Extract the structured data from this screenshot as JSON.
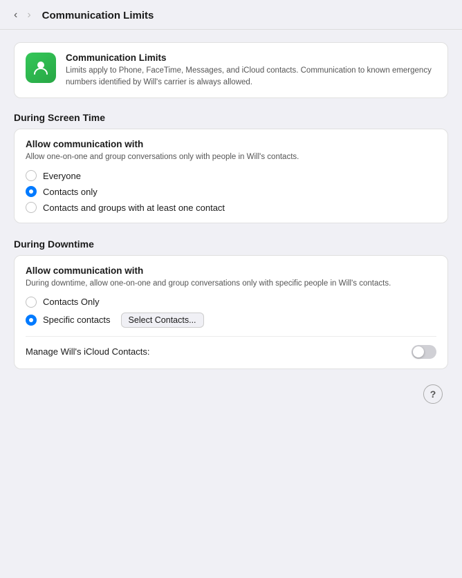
{
  "topBar": {
    "title": "Communication Limits",
    "backEnabled": true,
    "forwardEnabled": false
  },
  "infoCard": {
    "title": "Communication Limits",
    "description": "Limits apply to Phone, FaceTime, Messages, and iCloud contacts. Communication to known emergency numbers identified by Will's carrier is always allowed."
  },
  "screenTime": {
    "sectionHeading": "During Screen Time",
    "panelTitle": "Allow communication with",
    "panelDesc": "Allow one-on-one and group conversations only with people in Will's contacts.",
    "options": [
      {
        "id": "st-everyone",
        "label": "Everyone",
        "selected": false
      },
      {
        "id": "st-contacts-only",
        "label": "Contacts only",
        "selected": true
      },
      {
        "id": "st-contacts-groups",
        "label": "Contacts and groups with at least one contact",
        "selected": false
      }
    ]
  },
  "downtime": {
    "sectionHeading": "During Downtime",
    "panelTitle": "Allow communication with",
    "panelDesc": "During downtime, allow one-on-one and group conversations only with specific people in Will's contacts.",
    "options": [
      {
        "id": "dt-contacts-only",
        "label": "Contacts Only",
        "selected": false
      },
      {
        "id": "dt-specific",
        "label": "Specific contacts",
        "selected": true
      }
    ],
    "selectContactsBtn": "Select Contacts...",
    "icloudLabel": "Manage Will's iCloud Contacts:",
    "icloudOn": false
  },
  "helpBtn": "?"
}
